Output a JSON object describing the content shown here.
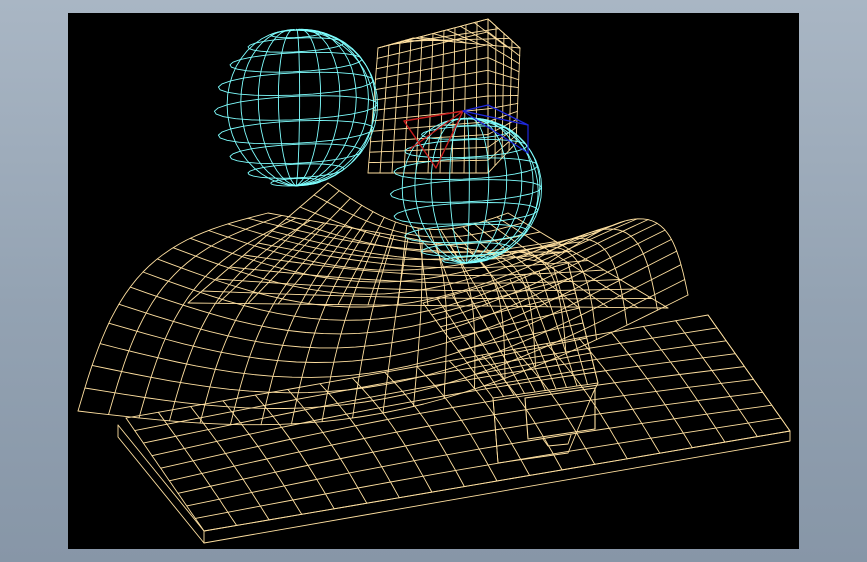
{
  "scene": {
    "background_color": "#000000",
    "frame_color": "#9aa8b8",
    "colors": {
      "surface": "#ffe0a0",
      "sphere": "#7fffff",
      "highlight_red": "#c81e1e",
      "highlight_blue": "#1e28dc",
      "solid_face": "#000000"
    },
    "objects": [
      "ground-slab-mesh",
      "saddle-surface-mesh",
      "back-block-mesh",
      "cyan-sphere-left",
      "cyan-sphere-right",
      "red-triangle-face",
      "blue-triangle-face",
      "small-box-solid"
    ]
  }
}
